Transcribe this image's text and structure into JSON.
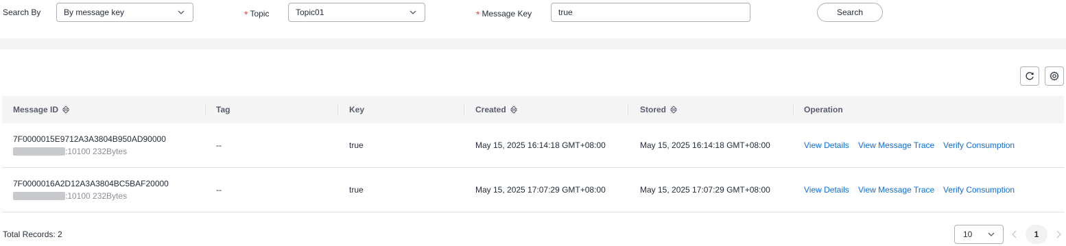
{
  "filters": {
    "search_by_label": "Search By",
    "search_by_value": "By message key",
    "topic_required": "*",
    "topic_label": "Topic",
    "topic_value": "Topic01",
    "key_required": "*",
    "key_label": "Message Key",
    "key_value": "true",
    "search_button": "Search"
  },
  "toolbar": {
    "refresh_icon": "refresh-icon",
    "settings_icon": "gear-icon"
  },
  "table": {
    "columns": [
      "Message ID",
      "Tag",
      "Key",
      "Created",
      "Stored",
      "Operation"
    ],
    "rows": [
      {
        "message_id": "7F0000015E9712A3A3804B950AD90000",
        "host_suffix": ":10100 232Bytes",
        "tag": "--",
        "key": "true",
        "created": "May 15, 2025 16:14:18 GMT+08:00",
        "stored": "May 15, 2025 16:14:18 GMT+08:00"
      },
      {
        "message_id": "7F0000016A2D12A3A3804BC5BAF20000",
        "host_suffix": ":10100 232Bytes",
        "tag": "--",
        "key": "true",
        "created": "May 15, 2025 17:07:29 GMT+08:00",
        "stored": "May 15, 2025 17:07:29 GMT+08:00"
      }
    ],
    "operations": [
      "View Details",
      "View Message Trace",
      "Verify Consumption"
    ]
  },
  "footer": {
    "total_records": "Total Records: 2",
    "page_size": "10",
    "current_page": "1"
  },
  "colors": {
    "link": "#0c6dd8",
    "required": "#e54545",
    "header_bg": "#f5f5f6"
  }
}
